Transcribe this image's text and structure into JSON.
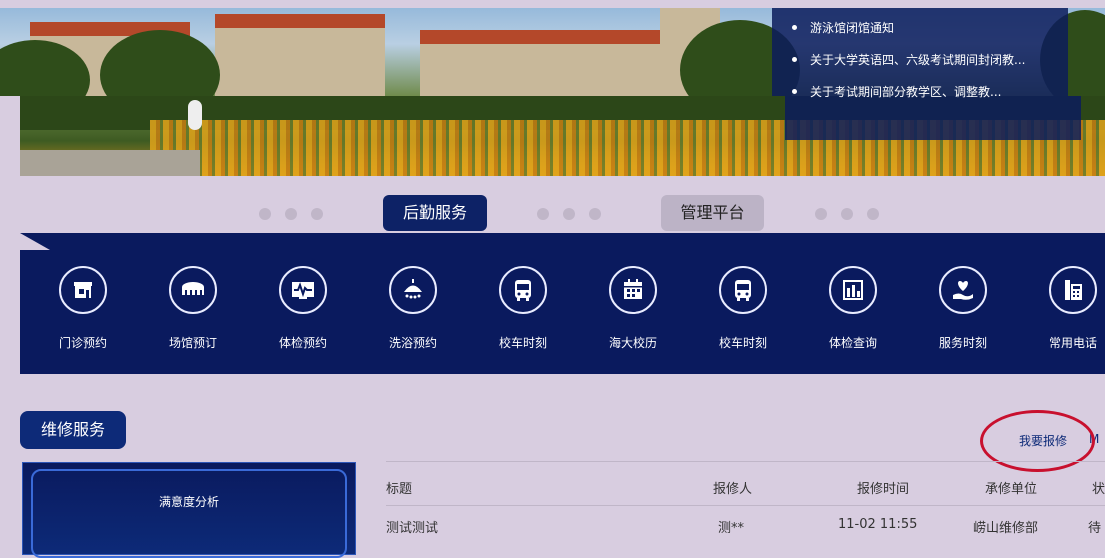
{
  "notices": [
    "游泳馆闭馆通知",
    "关于大学英语四、六级考试期间封闭教...",
    "关于考试期间部分教学区、调整教..."
  ],
  "tabs": {
    "logistics": "后勤服务",
    "admin": "管理平台"
  },
  "services": [
    {
      "label": "门诊预约",
      "icon": "clinic-icon"
    },
    {
      "label": "场馆预订",
      "icon": "stadium-icon"
    },
    {
      "label": "体检预约",
      "icon": "ecg-monitor-icon"
    },
    {
      "label": "洗浴预约",
      "icon": "shower-icon"
    },
    {
      "label": "校车时刻",
      "icon": "bus-icon"
    },
    {
      "label": "海大校历",
      "icon": "calendar-icon"
    },
    {
      "label": "校车时刻",
      "icon": "bus-icon"
    },
    {
      "label": "体检查询",
      "icon": "bar-chart-icon"
    },
    {
      "label": "服务时刻",
      "icon": "heart-hand-icon"
    },
    {
      "label": "常用电话",
      "icon": "telephone-icon"
    }
  ],
  "repair": {
    "title": "维修服务",
    "report_link": "我要报修",
    "more_link": "M",
    "analysis_title": "满意度分析",
    "columns": [
      "标题",
      "报修人",
      "报修时间",
      "承修单位",
      "状"
    ],
    "rows": [
      {
        "title": "测试测试",
        "reporter": "测**",
        "time": "11-02 11:55",
        "unit": "崂山维修部",
        "status": "待"
      }
    ]
  },
  "colors": {
    "navy": "#0a1a5e",
    "accent": "#0d2266",
    "background": "#d8cde0",
    "highlight": "#c8102e"
  }
}
